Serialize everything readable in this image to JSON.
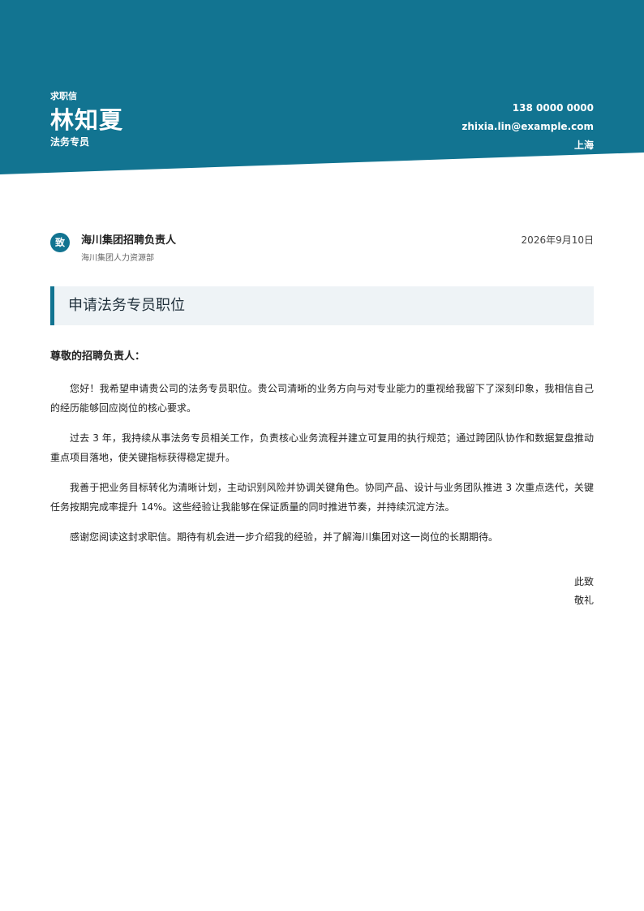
{
  "header": {
    "doc_type": "求职信",
    "name": "林知夏",
    "role": "法务专员",
    "contact": {
      "phone": "138 0000 0000",
      "email": "zhixia.lin@example.com",
      "city": "上海"
    }
  },
  "recipient": {
    "badge": "致",
    "name": "海川集团招聘负责人",
    "department": "海川集团人力资源部",
    "date": "2026年9月10日"
  },
  "subject": "申请法务专员职位",
  "salutation": "尊敬的招聘负责人：",
  "paragraphs": [
    "您好！我希望申请贵公司的法务专员职位。贵公司清晰的业务方向与对专业能力的重视给我留下了深刻印象，我相信自己的经历能够回应岗位的核心要求。",
    "过去 3 年，我持续从事法务专员相关工作，负责核心业务流程并建立可复用的执行规范；通过跨团队协作和数据复盘推动重点项目落地，使关键指标获得稳定提升。",
    "我善于把业务目标转化为清晰计划，主动识别风险并协调关键角色。协同产品、设计与业务团队推进 3 次重点迭代，关键任务按期完成率提升 14%。这些经验让我能够在保证质量的同时推进节奏，并持续沉淀方法。",
    "感谢您阅读这封求职信。期待有机会进一步介绍我的经验，并了解海川集团对这一岗位的长期期待。"
  ],
  "closing": {
    "line1": "此致",
    "line2": "敬礼"
  },
  "colors": {
    "accent": "#127491",
    "subject_bg": "#eef3f6"
  }
}
